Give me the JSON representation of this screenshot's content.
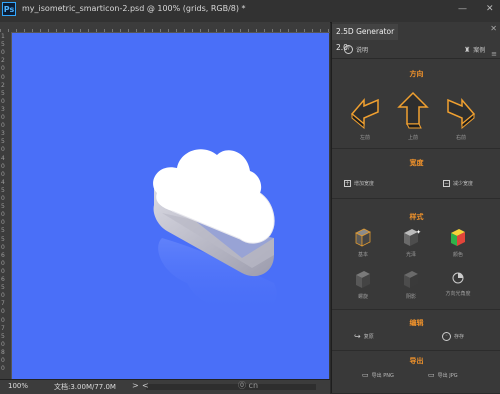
{
  "window": {
    "app_logo": "Ps",
    "title": "my_isometric_smarticon-2.psd @ 100% (grids, RGB/8) *",
    "minimize": "—",
    "close": "✕"
  },
  "rulers": {
    "left_labels": [
      "1",
      "5",
      "0",
      "2",
      "0",
      "0",
      "2",
      "5",
      "0",
      "3",
      "0",
      "0",
      "3",
      "5",
      "0",
      "4",
      "0",
      "0",
      "4",
      "5",
      "0",
      "5",
      "0",
      "0",
      "5",
      "5",
      "0",
      "6",
      "0",
      "0",
      "6",
      "5",
      "0",
      "7",
      "0",
      "0",
      "7",
      "5",
      "0",
      "8",
      "0",
      "0"
    ]
  },
  "canvas": {
    "background": "#4a6ff8",
    "icon": "cloud-isometric"
  },
  "statusbar": {
    "zoom": "100%",
    "doc_info": "文档:3.00M/77.0M",
    "arrow": ">",
    "scroll_left": "<",
    "watermark": "⓪ cn"
  },
  "panel": {
    "tab_label": "2.5D Generator 2.0",
    "close": "✕",
    "menu": "≡",
    "help_label": "说明",
    "case_label": "案例",
    "sections": {
      "direction": {
        "title": "方向",
        "items": [
          "左前",
          "上前",
          "右前"
        ]
      },
      "width": {
        "title": "宽度",
        "add": "增加宽度",
        "reduce": "减少宽度"
      },
      "style": {
        "title": "样式",
        "items": [
          "基本",
          "光泽",
          "颜色",
          "螺旋",
          "阴影",
          "方向光角度"
        ]
      },
      "edit": {
        "title": "编辑",
        "restore": "复原",
        "save": "存存"
      },
      "export": {
        "title": "导出",
        "png": "导出 PNG",
        "jpg": "导出 JPG"
      }
    }
  },
  "colors": {
    "accent_orange": "#f0922b",
    "canvas_blue": "#4a6ff8",
    "panel_bg": "#393939"
  }
}
